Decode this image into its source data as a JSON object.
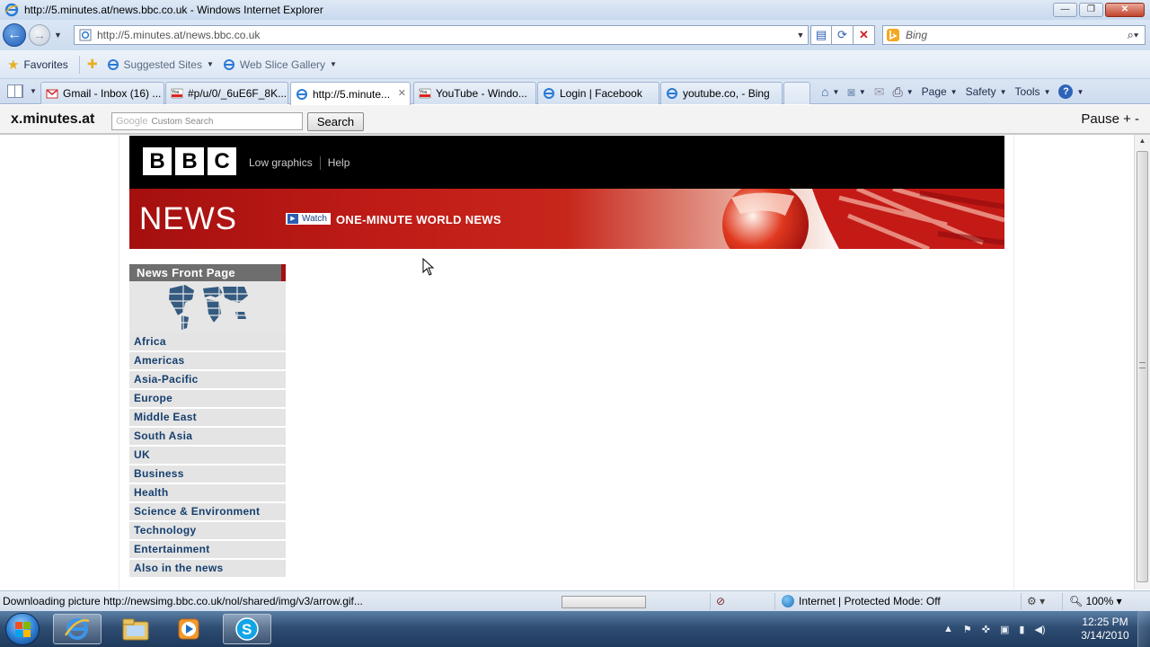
{
  "window": {
    "title": "http://5.minutes.at/news.bbc.co.uk - Windows Internet Explorer",
    "minimize": "—",
    "restore": "❐",
    "close": "✕"
  },
  "address_bar": {
    "url": "http://5.minutes.at/news.bbc.co.uk",
    "search_placeholder": "Bing"
  },
  "favorites_bar": {
    "favorites_label": "Favorites",
    "suggested_sites": "Suggested Sites",
    "web_slice_gallery": "Web Slice Gallery"
  },
  "tabs": [
    {
      "label": "Gmail - Inbox (16) ...",
      "icon": "gmail-icon",
      "active": false
    },
    {
      "label": "#p/u/0/_6uE6F_8K...",
      "icon": "youtube-icon",
      "active": false
    },
    {
      "label": "http://5.minute...",
      "icon": "ie-page-icon",
      "active": true
    },
    {
      "label": "YouTube - Windo...",
      "icon": "youtube-icon",
      "active": false
    },
    {
      "label": "Login | Facebook",
      "icon": "ie-page-icon",
      "active": false
    },
    {
      "label": "youtube.co, - Bing",
      "icon": "ie-page-icon",
      "active": false
    }
  ],
  "command_bar": {
    "page": "Page",
    "safety": "Safety",
    "tools": "Tools"
  },
  "minutes_toolbar": {
    "brand": "x.minutes.at",
    "google_label": "Google",
    "search_placeholder": "Custom Search",
    "search_button": "Search",
    "pause": "Pause + -"
  },
  "bbc": {
    "logo_letters": [
      "B",
      "B",
      "C"
    ],
    "links": [
      "Low graphics",
      "Help"
    ],
    "news_title": "NEWS",
    "watch_label": "Watch",
    "headline": "ONE-MINUTE WORLD NEWS",
    "nav_header": "News Front Page",
    "nav_items": [
      "Africa",
      "Americas",
      "Asia-Pacific",
      "Europe",
      "Middle East",
      "South Asia",
      "UK",
      "Business",
      "Health",
      "Science & Environment",
      "Technology",
      "Entertainment",
      "Also in the news"
    ]
  },
  "status_bar": {
    "message": "Downloading picture http://newsimg.bbc.co.uk/nol/shared/img/v3/arrow.gif...",
    "zone": "Internet | Protected Mode: Off",
    "zoom": "100%"
  },
  "taskbar": {
    "time": "12:25 PM",
    "date": "3/14/2010"
  },
  "colors": {
    "bbc_red": "#c01c17",
    "nav_link": "#163f6e",
    "nav_header_bg": "#6e6e6e"
  }
}
